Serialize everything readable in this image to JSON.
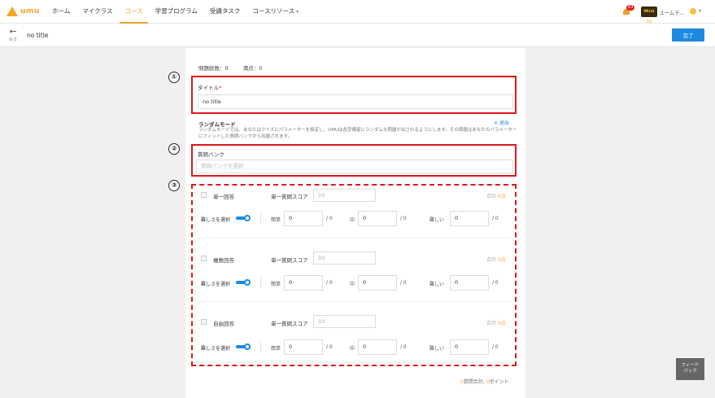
{
  "nav": {
    "logo": "umu",
    "items": [
      "ホーム",
      "マイクラス",
      "コース",
      "学習プログラム",
      "受講タスク",
      "コースリソース"
    ],
    "caret": "▾",
    "badge": "63",
    "avatar_text": "Mirai TV",
    "username": "ユームテ...",
    "user_caret": "▾"
  },
  "header": {
    "back_label": "戻る",
    "title": "no title",
    "done_button": "完了"
  },
  "form": {
    "stats_questions": "問題総数：0",
    "stats_points": "満点：0",
    "title_label": "タイトル",
    "required_mark": "*",
    "title_value": "no title",
    "random_mode_label": "ランダムモード",
    "exit_label": "✕ 退出",
    "random_desc": "ランダムモードでは、あなたはクイズにパラメーターを設定し、UMUは各受講者にランダムな問題が出されるようにします。その問題はあなたのパラメーターにフィットした質問バンクから出題されます。",
    "bank_label": "質問バンク",
    "bank_placeholder": "質問バンクを選択"
  },
  "annotations": [
    "①",
    "②",
    "③"
  ],
  "question_groups": [
    {
      "type": "単一回答",
      "score_label": "単一質問スコア",
      "score": "10",
      "total_prefix": "合計",
      "total_value": "0点",
      "difficulty_label": "難しさを選択",
      "easy_label": "簡単",
      "easy_value": "0",
      "easy_max": "/ 0",
      "mid_label": "中",
      "mid_value": "0",
      "mid_max": "/ 0",
      "hard_label": "難しい",
      "hard_value": "0",
      "hard_max": "/ 0"
    },
    {
      "type": "複数回答",
      "score_label": "単一質問スコア",
      "score": "10",
      "total_prefix": "合計",
      "total_value": "0点",
      "difficulty_label": "難しさを選択",
      "easy_label": "簡単",
      "easy_value": "0",
      "easy_max": "/ 0",
      "mid_label": "中",
      "mid_value": "0",
      "mid_max": "/ 0",
      "hard_label": "難しい",
      "hard_value": "0",
      "hard_max": "/ 0"
    },
    {
      "type": "自由回答",
      "score_label": "単一質問スコア",
      "score": "10",
      "total_prefix": "合計",
      "total_value": "0点",
      "difficulty_label": "難しさを選択",
      "easy_label": "簡単",
      "easy_value": "0",
      "easy_max": "/ 0",
      "mid_label": "中",
      "mid_value": "0",
      "mid_max": "/ 0",
      "hard_label": "難しい",
      "hard_value": "0",
      "hard_max": "/ 0"
    }
  ],
  "footer": {
    "count_value": "0",
    "count_label": "質問合計, ",
    "points_value": "0",
    "points_label": "ポイント"
  },
  "feedback": {
    "line1": "フィード",
    "line2": "バック"
  },
  "colors": {
    "accent": "#f5a623",
    "primary": "#1b8ae0",
    "annotation_red": "#e01818"
  }
}
